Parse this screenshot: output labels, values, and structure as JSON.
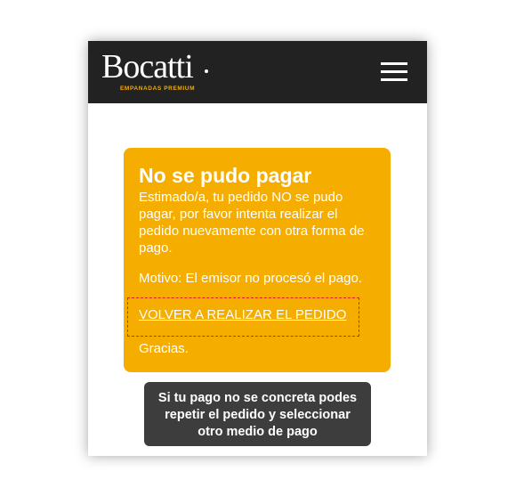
{
  "header": {
    "logo_text": "Bocatti",
    "logo_tagline": "EMPANADAS PREMIUM",
    "menu_icon": "hamburger-menu-icon"
  },
  "alert": {
    "title": "No se pudo pagar",
    "body": "Estimado/a, tu pedido NO se pudo pagar, por favor intenta realizar el pedido nuevamente con otra forma de pago.",
    "reason": "Motivo: El emisor no procesó el pago.",
    "retry_link": "VOLVER A REALIZAR EL PEDIDO",
    "thanks": "Gracias."
  },
  "tooltip": {
    "text": "Si tu pago no se concreta podes repetir el pedido y seleccionar otro medio de pago"
  },
  "colors": {
    "header_bg": "#222222",
    "alert_bg": "#f5ad00",
    "brand_accent": "#f5ad00",
    "tooltip_bg": "#3d3d3d",
    "highlight_border": "#e0201d"
  }
}
